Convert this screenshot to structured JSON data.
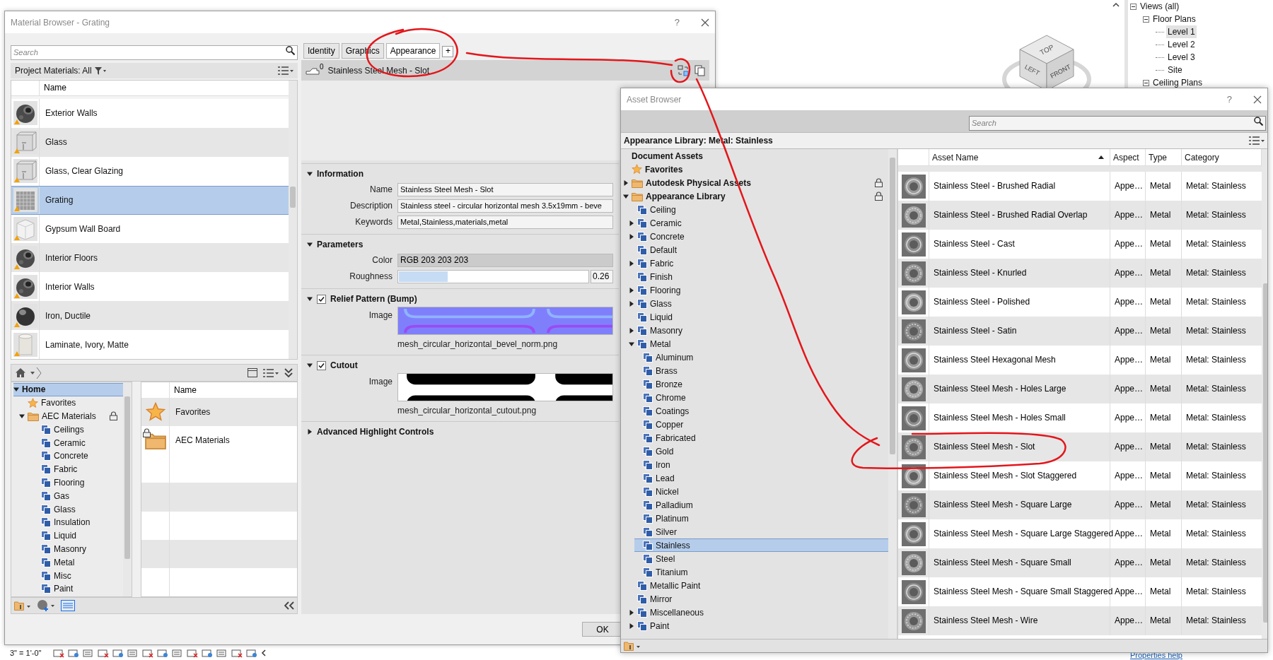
{
  "revit": {
    "view_cube": {
      "faces": [
        "TOP",
        "LEFT",
        "FRONT"
      ]
    },
    "project_tree": [
      {
        "label": "Views (all)",
        "expanded": true,
        "children": [
          {
            "label": "Floor Plans",
            "expanded": true,
            "children": [
              {
                "label": "Level 1",
                "selected": true
              },
              {
                "label": "Level 2",
                "selected": false
              },
              {
                "label": "Level 3",
                "selected": false
              },
              {
                "label": "Site",
                "selected": false
              }
            ]
          },
          {
            "label": "Ceiling Plans",
            "expanded": true
          }
        ]
      }
    ],
    "scale": "3\" = 1'-0\"",
    "properties_link": "Properties help"
  },
  "material_browser": {
    "title": "Material Browser - Grating",
    "help": "?",
    "search": {
      "placeholder": "Search"
    },
    "filter_label": "Project Materials: All",
    "list_column": "Name",
    "materials": [
      {
        "name": "Exterior Walls",
        "kind": "sphere",
        "selected": false
      },
      {
        "name": "Glass",
        "kind": "glass",
        "selected": false
      },
      {
        "name": "Glass, Clear Glazing",
        "kind": "glass",
        "selected": false
      },
      {
        "name": "Grating",
        "kind": "grating",
        "selected": true
      },
      {
        "name": "Gypsum Wall Board",
        "kind": "cube",
        "selected": false
      },
      {
        "name": "Interior Floors",
        "kind": "sphere",
        "selected": false
      },
      {
        "name": "Interior Walls",
        "kind": "sphere",
        "selected": false
      },
      {
        "name": "Iron, Ductile",
        "kind": "ball",
        "selected": false
      },
      {
        "name": "Laminate, Ivory, Matte",
        "kind": "cylinder",
        "selected": false
      }
    ],
    "library_tree": [
      {
        "label": "Home",
        "expanded": true,
        "selected": true,
        "children": [
          {
            "label": "Favorites",
            "kind": "star",
            "selected": false
          },
          {
            "label": "AEC Materials",
            "kind": "folder",
            "expanded": true,
            "locked": true,
            "selected": false,
            "children": [
              {
                "label": "Ceilings",
                "kind": "category",
                "selected": false
              },
              {
                "label": "Ceramic",
                "kind": "category",
                "selected": false
              },
              {
                "label": "Concrete",
                "kind": "category",
                "selected": false
              },
              {
                "label": "Fabric",
                "kind": "category",
                "selected": false
              },
              {
                "label": "Flooring",
                "kind": "category",
                "selected": false
              },
              {
                "label": "Gas",
                "kind": "category",
                "selected": false
              },
              {
                "label": "Glass",
                "kind": "category",
                "selected": false
              },
              {
                "label": "Insulation",
                "kind": "category",
                "selected": false
              },
              {
                "label": "Liquid",
                "kind": "category",
                "selected": false
              },
              {
                "label": "Masonry",
                "kind": "category",
                "selected": false
              },
              {
                "label": "Metal",
                "kind": "category",
                "selected": false
              },
              {
                "label": "Misc",
                "kind": "category",
                "selected": false
              },
              {
                "label": "Paint",
                "kind": "category",
                "selected": false
              }
            ]
          }
        ]
      }
    ],
    "library_column": "Name",
    "library_items": [
      {
        "label": "Favorites",
        "kind": "star"
      },
      {
        "label": "AEC Materials",
        "kind": "folder",
        "locked": true
      }
    ],
    "tabs": [
      {
        "label": "Identity",
        "selected": false
      },
      {
        "label": "Graphics",
        "selected": false
      },
      {
        "label": "Appearance",
        "selected": true
      }
    ],
    "add_tab": "+",
    "asset_header": {
      "count": "0",
      "name": "Stainless Steel Mesh - Slot"
    },
    "sections": [
      {
        "title": "Information",
        "expanded": true,
        "fields": [
          {
            "label": "Name",
            "kind": "text",
            "value": "Stainless Steel Mesh - Slot"
          },
          {
            "label": "Description",
            "kind": "text",
            "value": "Stainless steel - circular horizontal mesh 3.5x19mm - beve"
          },
          {
            "label": "Keywords",
            "kind": "text",
            "value": "Metal,Stainless,materials,metal"
          }
        ]
      },
      {
        "title": "Parameters",
        "expanded": true,
        "fields": [
          {
            "label": "Color",
            "kind": "color",
            "value": "RGB 203 203 203"
          },
          {
            "label": "Roughness",
            "kind": "slider",
            "level": 0.26,
            "reading": "0.26"
          }
        ]
      },
      {
        "title": "Relief Pattern (Bump)",
        "expanded": true,
        "checked": true,
        "fields": [
          {
            "label": "Image",
            "kind": "bump",
            "file": "mesh_circular_horizontal_bevel_norm.png"
          }
        ]
      },
      {
        "title": "Cutout",
        "expanded": true,
        "checked": true,
        "fields": [
          {
            "label": "Image",
            "kind": "cutout",
            "file": "mesh_circular_horizontal_cutout.png"
          }
        ]
      },
      {
        "title": "Advanced Highlight Controls",
        "expanded": false
      }
    ],
    "ok": "OK"
  },
  "asset_browser": {
    "title": "Asset Browser",
    "help": "?",
    "search": {
      "placeholder": "Search"
    },
    "path": "Appearance Library: Metal: Stainless",
    "tree": [
      {
        "label": "Document Assets",
        "selected": false
      },
      {
        "label": "Favorites",
        "kind": "star",
        "selected": false
      },
      {
        "label": "Autodesk Physical Assets",
        "kind": "folder",
        "expanded": false,
        "locked": true,
        "selected": false
      },
      {
        "label": "Appearance Library",
        "kind": "folder",
        "expanded": true,
        "locked": true,
        "selected": false,
        "children": [
          {
            "label": "Ceiling",
            "kind": "category",
            "selected": false
          },
          {
            "label": "Ceramic",
            "kind": "category",
            "expanded": false,
            "selected": false
          },
          {
            "label": "Concrete",
            "kind": "category",
            "expanded": false,
            "selected": false
          },
          {
            "label": "Default",
            "kind": "category",
            "selected": false
          },
          {
            "label": "Fabric",
            "kind": "category",
            "expanded": false,
            "selected": false
          },
          {
            "label": "Finish",
            "kind": "category",
            "selected": false
          },
          {
            "label": "Flooring",
            "kind": "category",
            "expanded": false,
            "selected": false
          },
          {
            "label": "Glass",
            "kind": "category",
            "expanded": false,
            "selected": false
          },
          {
            "label": "Liquid",
            "kind": "category",
            "selected": false
          },
          {
            "label": "Masonry",
            "kind": "category",
            "expanded": false,
            "selected": false
          },
          {
            "label": "Metal",
            "kind": "category",
            "expanded": true,
            "selected": false,
            "children": [
              {
                "label": "Aluminum",
                "kind": "category",
                "selected": false
              },
              {
                "label": "Brass",
                "kind": "category",
                "selected": false
              },
              {
                "label": "Bronze",
                "kind": "category",
                "selected": false
              },
              {
                "label": "Chrome",
                "kind": "category",
                "selected": false
              },
              {
                "label": "Coatings",
                "kind": "category",
                "selected": false
              },
              {
                "label": "Copper",
                "kind": "category",
                "selected": false
              },
              {
                "label": "Fabricated",
                "kind": "category",
                "selected": false
              },
              {
                "label": "Gold",
                "kind": "category",
                "selected": false
              },
              {
                "label": "Iron",
                "kind": "category",
                "selected": false
              },
              {
                "label": "Lead",
                "kind": "category",
                "selected": false
              },
              {
                "label": "Nickel",
                "kind": "category",
                "selected": false
              },
              {
                "label": "Palladium",
                "kind": "category",
                "selected": false
              },
              {
                "label": "Platinum",
                "kind": "category",
                "selected": false
              },
              {
                "label": "Silver",
                "kind": "category",
                "selected": false
              },
              {
                "label": "Stainless",
                "kind": "category",
                "selected": true
              },
              {
                "label": "Steel",
                "kind": "category",
                "selected": false
              },
              {
                "label": "Titanium",
                "kind": "category",
                "selected": false
              }
            ]
          },
          {
            "label": "Metallic Paint",
            "kind": "category",
            "selected": false
          },
          {
            "label": "Mirror",
            "kind": "category",
            "selected": false
          },
          {
            "label": "Miscellaneous",
            "kind": "category",
            "expanded": false,
            "selected": false
          },
          {
            "label": "Paint",
            "kind": "category",
            "expanded": false,
            "selected": false
          }
        ]
      }
    ],
    "columns": [
      {
        "label": "Asset Name",
        "sorted": true
      },
      {
        "label": "Aspect"
      },
      {
        "label": "Type"
      },
      {
        "label": "Category"
      }
    ],
    "rows": [
      {
        "name": "Stainless Steel - Brushed Radial",
        "aspect": "Appe…",
        "type": "Metal",
        "category": "Metal: Stainless"
      },
      {
        "name": "Stainless Steel - Brushed Radial Overlap",
        "aspect": "Appe…",
        "type": "Metal",
        "category": "Metal: Stainless"
      },
      {
        "name": "Stainless Steel - Cast",
        "aspect": "Appe…",
        "type": "Metal",
        "category": "Metal: Stainless"
      },
      {
        "name": "Stainless Steel - Knurled",
        "aspect": "Appe…",
        "type": "Metal",
        "category": "Metal: Stainless"
      },
      {
        "name": "Stainless Steel - Polished",
        "aspect": "Appe…",
        "type": "Metal",
        "category": "Metal: Stainless"
      },
      {
        "name": "Stainless Steel - Satin",
        "aspect": "Appe…",
        "type": "Metal",
        "category": "Metal: Stainless"
      },
      {
        "name": "Stainless Steel Hexagonal Mesh",
        "aspect": "Appe…",
        "type": "Metal",
        "category": "Metal: Stainless"
      },
      {
        "name": "Stainless Steel Mesh - Holes Large",
        "aspect": "Appe…",
        "type": "Metal",
        "category": "Metal: Stainless"
      },
      {
        "name": "Stainless Steel Mesh - Holes Small",
        "aspect": "Appe…",
        "type": "Metal",
        "category": "Metal: Stainless"
      },
      {
        "name": "Stainless Steel Mesh - Slot",
        "aspect": "Appe…",
        "type": "Metal",
        "category": "Metal: Stainless"
      },
      {
        "name": "Stainless Steel Mesh - Slot Staggered",
        "aspect": "Appe…",
        "type": "Metal",
        "category": "Metal: Stainless"
      },
      {
        "name": "Stainless Steel Mesh - Square Large",
        "aspect": "Appe…",
        "type": "Metal",
        "category": "Metal: Stainless"
      },
      {
        "name": "Stainless Steel Mesh - Square Large Staggered",
        "aspect": "Appe…",
        "type": "Metal",
        "category": "Metal: Stainless"
      },
      {
        "name": "Stainless Steel Mesh - Square Small",
        "aspect": "Appe…",
        "type": "Metal",
        "category": "Metal: Stainless"
      },
      {
        "name": "Stainless Steel Mesh - Square Small Staggered",
        "aspect": "Appe…",
        "type": "Metal",
        "category": "Metal: Stainless"
      },
      {
        "name": "Stainless Steel Mesh - Wire",
        "aspect": "Appe…",
        "type": "Metal",
        "category": "Metal: Stainless"
      }
    ]
  }
}
